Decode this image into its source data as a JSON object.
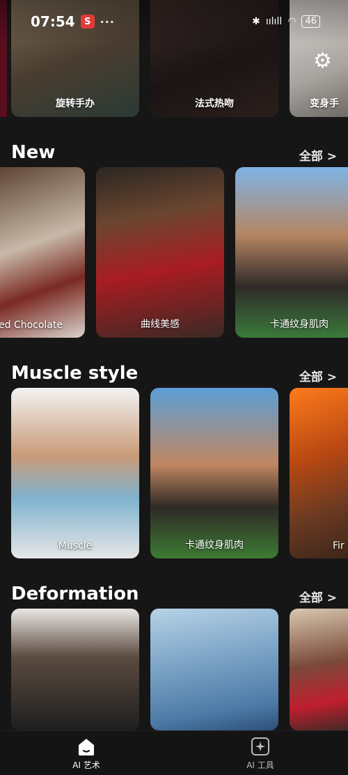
{
  "status_bar": {
    "time": "07:54",
    "app_badge": "S",
    "dots": "···",
    "signal": "ıılıll",
    "wifi": "◠",
    "battery": "46"
  },
  "top_strip": {
    "cards": [
      {
        "caption": "旋转手办"
      },
      {
        "caption": "法式热吻"
      },
      {
        "caption": "变身手"
      }
    ]
  },
  "sections": [
    {
      "title": "New",
      "see_all": "全部 >",
      "items": [
        {
          "caption": "ed Chocolate"
        },
        {
          "caption": "曲线美感"
        },
        {
          "caption": "卡通纹身肌肉"
        }
      ]
    },
    {
      "title": "Muscle style",
      "see_all": "全部 >",
      "items": [
        {
          "caption": "Muscle"
        },
        {
          "caption": "卡通纹身肌肉"
        },
        {
          "caption": "Fir"
        }
      ]
    },
    {
      "title": "Deformation",
      "see_all": "全部 >",
      "items": [
        {
          "caption": ""
        },
        {
          "caption": ""
        },
        {
          "caption": ""
        }
      ]
    }
  ],
  "bottom_nav": {
    "items": [
      {
        "label": "AI 艺术",
        "icon": "home-icon",
        "active": true
      },
      {
        "label": "AI 工具",
        "icon": "sparkle-icon",
        "active": false
      }
    ]
  },
  "colors": {
    "background": "#161616",
    "nav_background": "#141414",
    "text": "#ffffff"
  }
}
